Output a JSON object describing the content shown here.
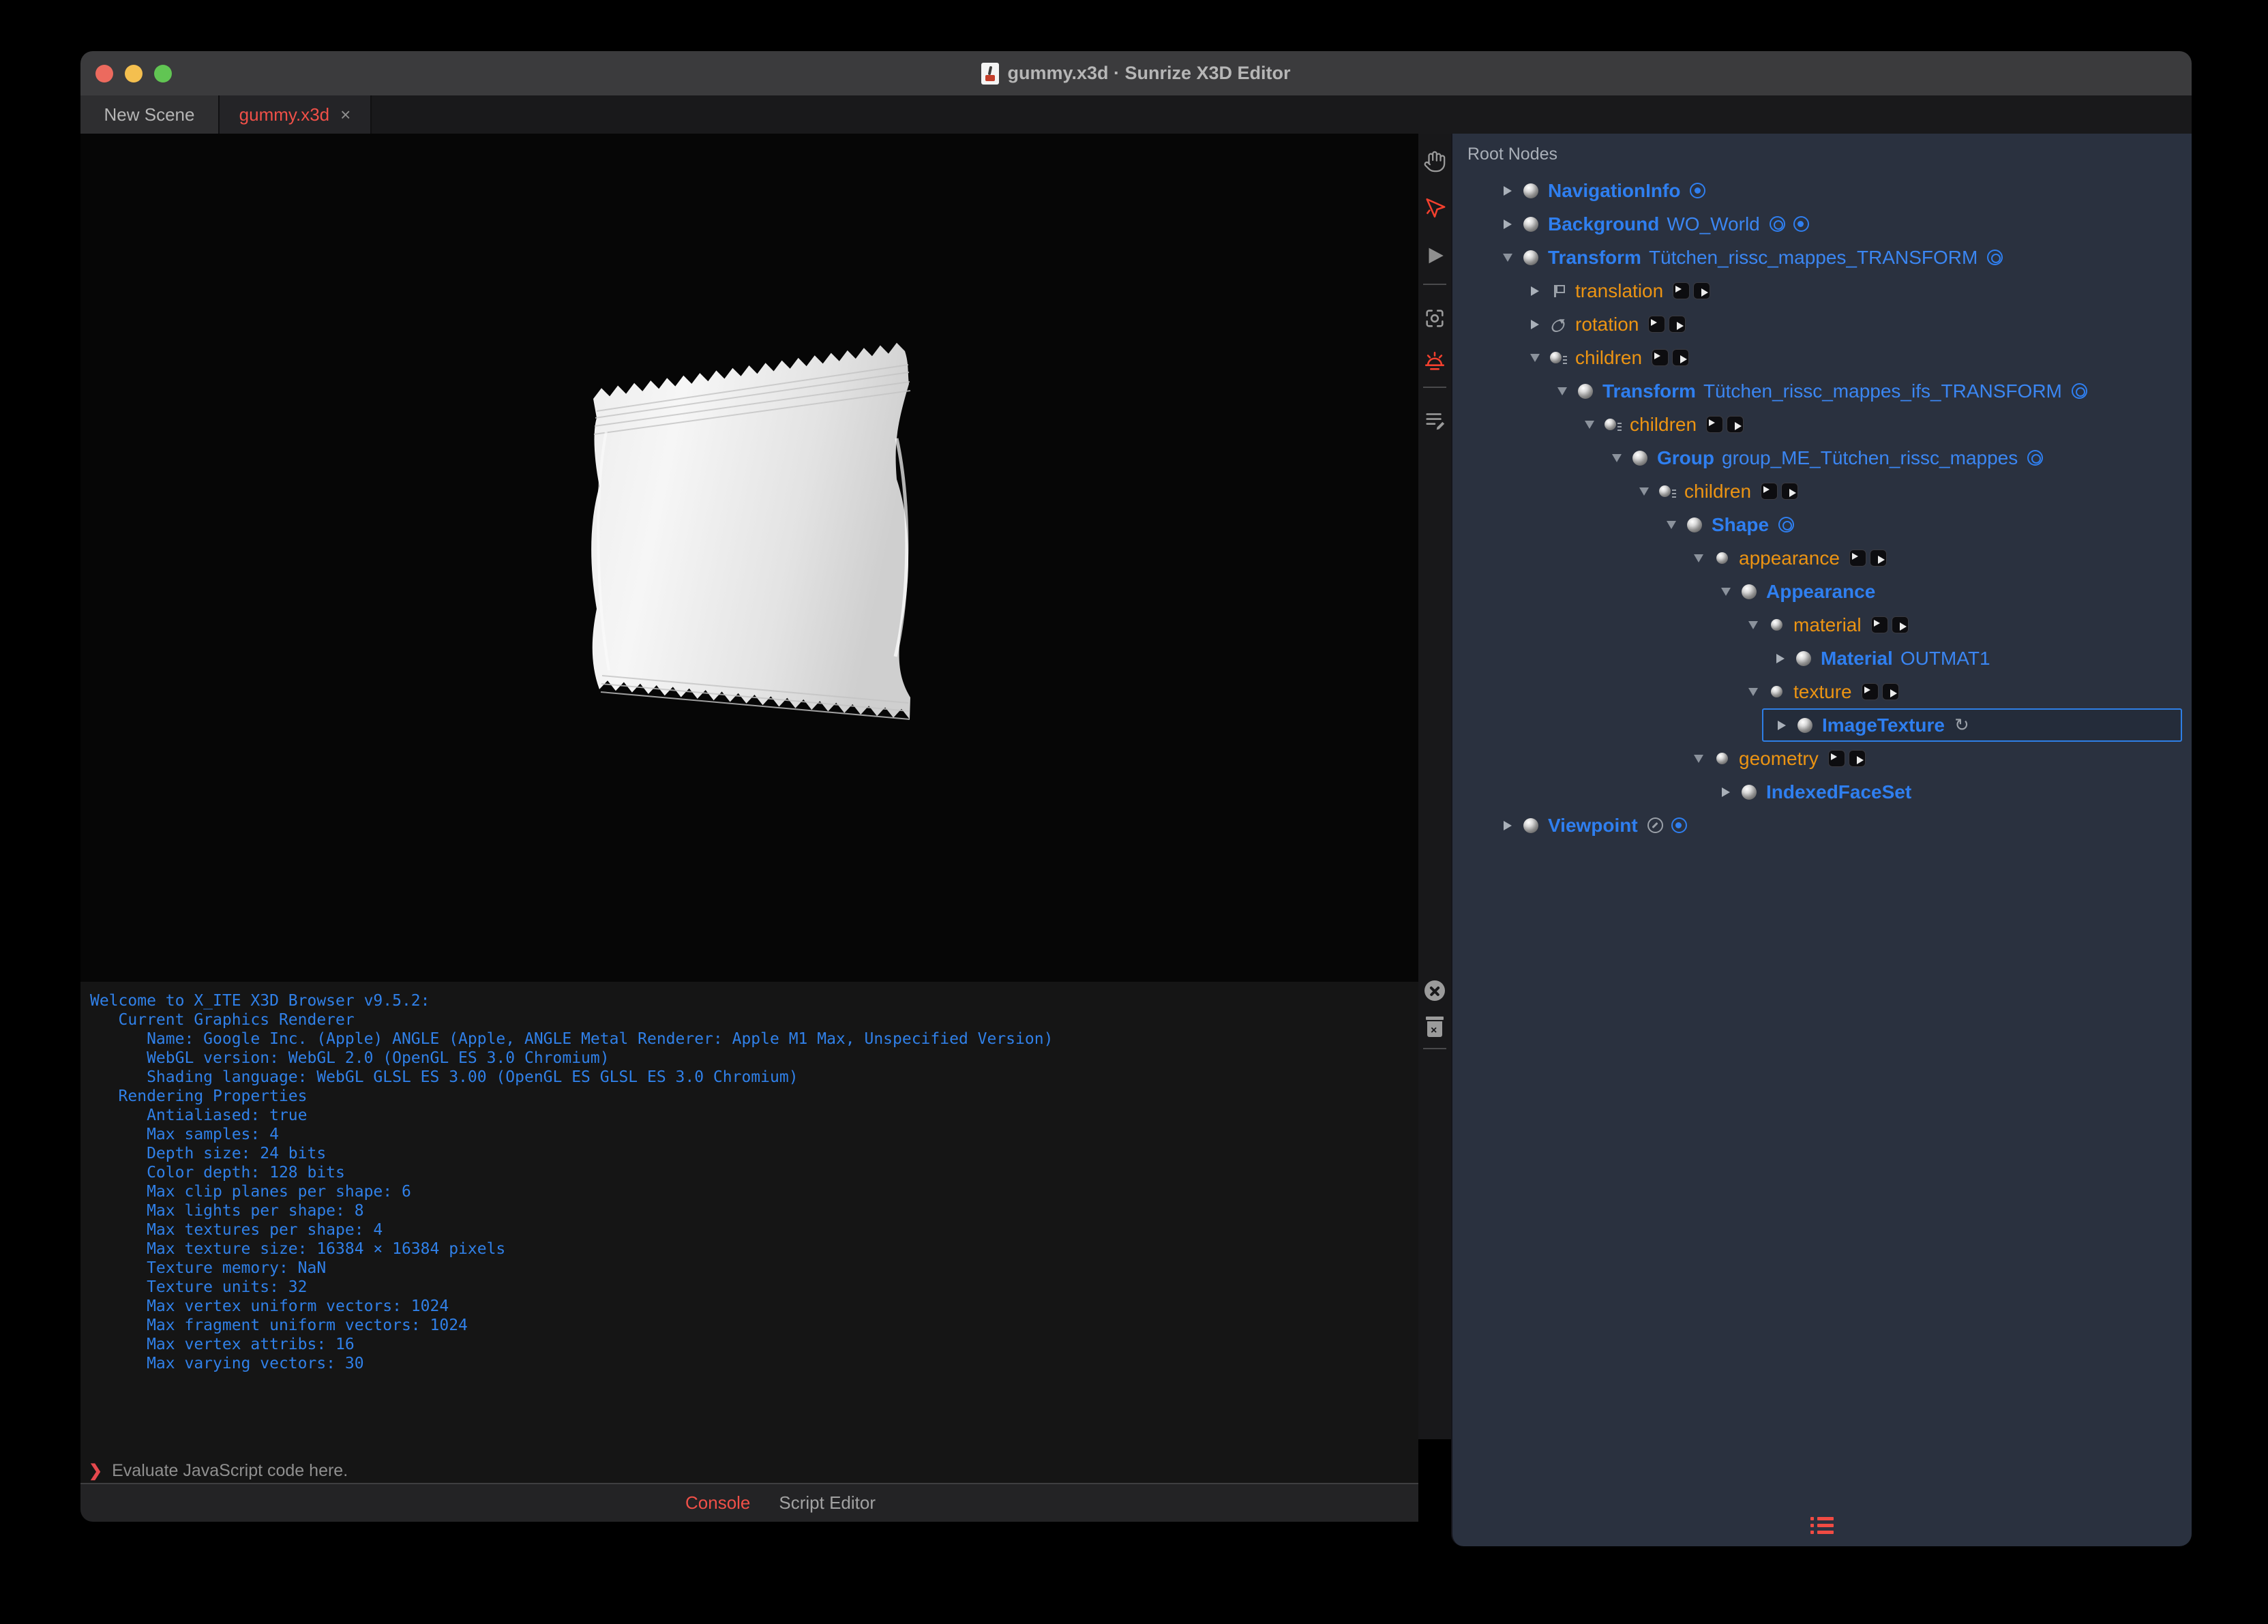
{
  "window": {
    "title": "gummy.x3d · Sunrize X3D Editor"
  },
  "tabs": {
    "new_scene": "New Scene",
    "document": "gummy.x3d",
    "close_glyph": "×"
  },
  "toolbar": {
    "icons": [
      "pan-hand",
      "select-arrow",
      "play",
      "snapshot",
      "light",
      "script-edit"
    ],
    "active_color": "#f3402e"
  },
  "viewport": {
    "object": "white flow-wrap sachet package render"
  },
  "console": {
    "lines": [
      "Welcome to X_ITE X3D Browser v9.5.2:",
      "   Current Graphics Renderer",
      "      Name: Google Inc. (Apple) ANGLE (Apple, ANGLE Metal Renderer: Apple M1 Max, Unspecified Version)",
      "      WebGL version: WebGL 2.0 (OpenGL ES 3.0 Chromium)",
      "      Shading language: WebGL GLSL ES 3.00 (OpenGL ES GLSL ES 3.0 Chromium)",
      "   Rendering Properties",
      "      Antialiased: true",
      "      Max samples: 4",
      "      Depth size: 24 bits",
      "      Color depth: 128 bits",
      "      Max clip planes per shape: 6",
      "      Max lights per shape: 8",
      "      Max textures per shape: 4",
      "      Max texture size: 16384 × 16384 pixels",
      "      Texture memory: NaN",
      "      Texture units: 32",
      "      Max vertex uniform vectors: 1024",
      "      Max fragment uniform vectors: 1024",
      "      Max vertex attribs: 16",
      "      Max varying vectors: 30"
    ],
    "prompt": "❯",
    "input_placeholder": "Evaluate JavaScript code here.",
    "text_color": "#3080e8"
  },
  "bottom_tabs": {
    "console": "Console",
    "script_editor": "Script Editor",
    "active": "Console",
    "active_color": "#f05048"
  },
  "outline": {
    "header": "Root Nodes",
    "rows": [
      {
        "level": 0,
        "exp": "closed",
        "icon": "ball",
        "kind": "node",
        "name": "NavigationInfo",
        "def": "",
        "trail": [
          "target"
        ],
        "selected": false
      },
      {
        "level": 0,
        "exp": "closed",
        "icon": "ball",
        "kind": "node",
        "name": "Background",
        "def": "WO_World",
        "trail": [
          "eye",
          "target"
        ],
        "selected": false
      },
      {
        "level": 0,
        "exp": "open",
        "icon": "ball",
        "kind": "node",
        "name": "Transform",
        "def": "Tütchen_rissc_mappes_TRANSFORM",
        "trail": [
          "eye"
        ],
        "selected": false
      },
      {
        "level": 1,
        "exp": "closed",
        "icon": "translation",
        "kind": "field",
        "name": "translation",
        "def": "",
        "trail": [
          "route"
        ],
        "selected": false
      },
      {
        "level": 1,
        "exp": "closed",
        "icon": "rotation",
        "kind": "field",
        "name": "rotation",
        "def": "",
        "trail": [
          "route"
        ],
        "selected": false
      },
      {
        "level": 1,
        "exp": "open",
        "icon": "children",
        "kind": "field",
        "name": "children",
        "def": "",
        "trail": [
          "route"
        ],
        "selected": false
      },
      {
        "level": 2,
        "exp": "open",
        "icon": "ball",
        "kind": "node",
        "name": "Transform",
        "def": "Tütchen_rissc_mappes_ifs_TRANSFORM",
        "trail": [
          "eye"
        ],
        "selected": false
      },
      {
        "level": 3,
        "exp": "open",
        "icon": "children",
        "kind": "field",
        "name": "children",
        "def": "",
        "trail": [
          "route"
        ],
        "selected": false
      },
      {
        "level": 4,
        "exp": "open",
        "icon": "ball",
        "kind": "node",
        "name": "Group",
        "def": "group_ME_Tütchen_rissc_mappes",
        "trail": [
          "eye"
        ],
        "selected": false
      },
      {
        "level": 5,
        "exp": "open",
        "icon": "children",
        "kind": "field",
        "name": "children",
        "def": "",
        "trail": [
          "route"
        ],
        "selected": false
      },
      {
        "level": 6,
        "exp": "open",
        "icon": "ball",
        "kind": "node",
        "name": "Shape",
        "def": "",
        "trail": [
          "eye"
        ],
        "selected": false
      },
      {
        "level": 7,
        "exp": "open",
        "icon": "smallball",
        "kind": "field",
        "name": "appearance",
        "def": "",
        "trail": [
          "route"
        ],
        "selected": false
      },
      {
        "level": 8,
        "exp": "open",
        "icon": "ball",
        "kind": "node",
        "name": "Appearance",
        "def": "",
        "trail": [],
        "selected": false
      },
      {
        "level": 9,
        "exp": "open",
        "icon": "smallball",
        "kind": "field",
        "name": "material",
        "def": "",
        "trail": [
          "route"
        ],
        "selected": false
      },
      {
        "level": 10,
        "exp": "closed",
        "icon": "ball",
        "kind": "node",
        "name": "Material",
        "def": "OUTMAT1",
        "trail": [],
        "selected": false
      },
      {
        "level": 9,
        "exp": "open",
        "icon": "smallball",
        "kind": "field",
        "name": "texture",
        "def": "",
        "trail": [
          "route"
        ],
        "selected": false
      },
      {
        "level": 10,
        "exp": "closed",
        "icon": "ball",
        "kind": "node",
        "name": "ImageTexture",
        "def": "",
        "trail": [
          "refresh"
        ],
        "selected": true
      },
      {
        "level": 7,
        "exp": "open",
        "icon": "smallball",
        "kind": "field",
        "name": "geometry",
        "def": "",
        "trail": [
          "route"
        ],
        "selected": false
      },
      {
        "level": 8,
        "exp": "closed",
        "icon": "ball",
        "kind": "node",
        "name": "IndexedFaceSet",
        "def": "",
        "trail": [],
        "selected": false
      },
      {
        "level": 0,
        "exp": "closed",
        "icon": "ball",
        "kind": "node",
        "name": "Viewpoint",
        "def": "",
        "trail": [
          "wrench",
          "target"
        ],
        "selected": false
      }
    ],
    "colors": {
      "panel_bg": "#2a313f",
      "node_name": "#2f7ff0",
      "field_name": "#ec9413",
      "selection_border": "#2e7fe6"
    }
  }
}
